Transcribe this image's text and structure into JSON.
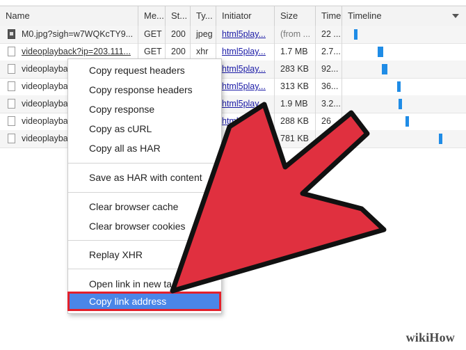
{
  "columns": [
    "Name",
    "Me...",
    "St...",
    "Ty...",
    "Initiator",
    "Size",
    "Time",
    "Timeline"
  ],
  "rows": [
    {
      "name": "M0.jpg?sigh=w7WQKcTY9...",
      "method": "GET",
      "status": "200",
      "type": "jpeg",
      "initiator": "html5play...",
      "size": "(from ...",
      "time": "22 ...",
      "icon": "image-file-icon",
      "bar": 0.05
    },
    {
      "name": "videoplayback?ip=203.111...",
      "method": "GET",
      "status": "200",
      "type": "xhr",
      "initiator": "html5play...",
      "size": "1.7 MB",
      "time": "2.7...",
      "icon": "file-icon",
      "bar": 0.25
    },
    {
      "name": "videoplayba",
      "method": "",
      "status": "",
      "type": "",
      "initiator": "html5play...",
      "size": "283 KB",
      "time": "92...",
      "icon": "file-icon",
      "bar": 0.29
    },
    {
      "name": "videoplayba",
      "method": "",
      "status": "",
      "type": "",
      "initiator": "html5play...",
      "size": "313 KB",
      "time": "36...",
      "icon": "file-icon",
      "bar": 0.42
    },
    {
      "name": "videoplayba",
      "method": "",
      "status": "",
      "type": "",
      "initiator": "html5play...",
      "size": "1.9 MB",
      "time": "3.2...",
      "icon": "file-icon",
      "bar": 0.43
    },
    {
      "name": "videoplayba",
      "method": "",
      "status": "",
      "type": "",
      "initiator": "html5p",
      "size": "288 KB",
      "time": "26",
      "icon": "file-icon",
      "bar": 0.49
    },
    {
      "name": "videoplayba",
      "method": "",
      "status": "",
      "type": "",
      "initiator": "",
      "size": "781 KB",
      "time": "",
      "icon": "file-icon",
      "bar": 0.77
    }
  ],
  "context_menu": {
    "items": [
      "Copy request headers",
      "Copy response headers",
      "Copy response",
      "Copy as cURL",
      "Copy all as HAR",
      "Save as HAR with content",
      "Clear browser cache",
      "Clear browser cookies",
      "Replay XHR",
      "Open link in new ta",
      "Copy link address"
    ],
    "highlighted": "Copy link address"
  },
  "colors": {
    "accent": "#4a86e8",
    "highlight_border": "#e3202b",
    "arrow_fill": "#e0303f",
    "timeline_bar": "#1f8ce6"
  },
  "watermark": "wikiHow"
}
